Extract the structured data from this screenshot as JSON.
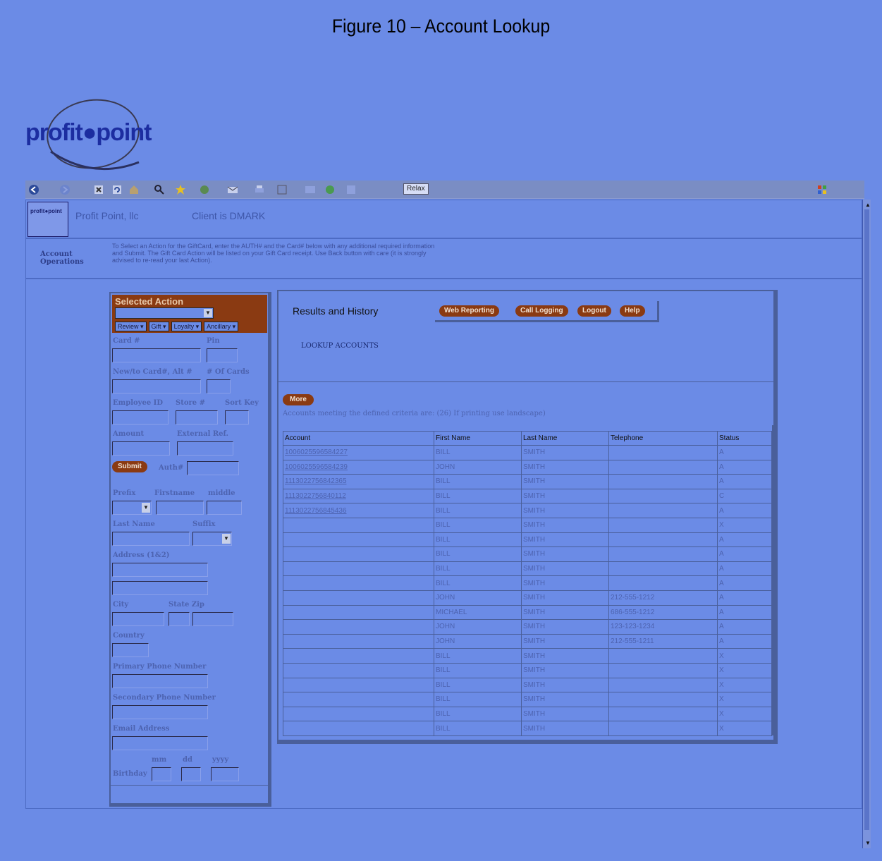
{
  "figure_title": "Figure 10 – Account Lookup",
  "logo_text": "profit●point",
  "toolbar": {
    "button_label": "Relax"
  },
  "header": {
    "logo_text": "profit●point",
    "company": "Profit Point, llc",
    "client": "Client is DMARK"
  },
  "operations": {
    "label_line1": "Account",
    "label_line2": "Operations",
    "help_text": "To Select an Action for the GiftCard, enter the AUTH# and the Card# below with any additional required information and Submit. The Gift Card Action will be listed on your Gift Card receipt. Use Back button with care (it is strongly advised to re-read your last Action)."
  },
  "left_panel": {
    "selected_action_title": "Selected Action",
    "menus": [
      "Review ▾",
      "Gift ▾",
      "Loyalty ▾",
      "Ancillary ▾"
    ],
    "labels": {
      "card": "Card #",
      "pin": "Pin",
      "new_card": "New/to Card#, Alt #",
      "num_cards": "# Of Cards",
      "employee_id": "Employee ID",
      "store": "Store #",
      "sort_key": "Sort Key",
      "amount": "Amount",
      "external_ref": "External Ref.",
      "auth": "Auth#",
      "prefix": "Prefix",
      "firstname": "Firstname",
      "middle": "middle",
      "last_name": "Last Name",
      "suffix": "Suffix",
      "address": "Address (1&2)",
      "city": "City",
      "state_zip": "State Zip",
      "country": "Country",
      "primary_phone": "Primary Phone Number",
      "secondary_phone": "Secondary Phone Number",
      "email": "Email Address",
      "mm": "mm",
      "dd": "dd",
      "yyyy": "yyyy",
      "birthday": "Birthday"
    },
    "submit_label": "Submit"
  },
  "results": {
    "title": "Results and History",
    "buttons": [
      "Web Reporting",
      "Call Logging",
      "Logout",
      "Help"
    ],
    "lookup_label": "LOOKUP ACCOUNTS",
    "more_label": "More",
    "info_text": "Accounts meeting the defined criteria are: (26) If printing use landscape)",
    "columns": [
      "Account",
      "First Name",
      "Last Name",
      "Telephone",
      "Status"
    ],
    "rows": [
      [
        "1006025596584227",
        "BILL",
        "SMITH",
        "",
        "A"
      ],
      [
        "1006025596584239",
        "JOHN",
        "SMITH",
        "",
        "A"
      ],
      [
        "1113022756842365",
        "BILL",
        "SMITH",
        "",
        "A"
      ],
      [
        "1113022756840112",
        "BILL",
        "SMITH",
        "",
        "C"
      ],
      [
        "1113022756845436",
        "BILL",
        "SMITH",
        "",
        "A"
      ],
      [
        "",
        "BILL",
        "SMITH",
        "",
        "X"
      ],
      [
        "",
        "BILL",
        "SMITH",
        "",
        "A"
      ],
      [
        "",
        "BILL",
        "SMITH",
        "",
        "A"
      ],
      [
        "",
        "BILL",
        "SMITH",
        "",
        "A"
      ],
      [
        "",
        "BILL",
        "SMITH",
        "",
        "A"
      ],
      [
        "",
        "JOHN",
        "SMITH",
        "212-555-1212",
        "A"
      ],
      [
        "",
        "MICHAEL",
        "SMITH",
        "686-555-1212",
        "A"
      ],
      [
        "",
        "JOHN",
        "SMITH",
        "123-123-1234",
        "A"
      ],
      [
        "",
        "JOHN",
        "SMITH",
        "212-555-1211",
        "A"
      ],
      [
        "",
        "BILL",
        "SMITH",
        "",
        "X"
      ],
      [
        "",
        "BILL",
        "SMITH",
        "",
        "X"
      ],
      [
        "",
        "BILL",
        "SMITH",
        "",
        "X"
      ],
      [
        "",
        "BILL",
        "SMITH",
        "",
        "X"
      ],
      [
        "",
        "BILL",
        "SMITH",
        "",
        "X"
      ],
      [
        "",
        "BILL",
        "SMITH",
        "",
        "X"
      ]
    ]
  }
}
